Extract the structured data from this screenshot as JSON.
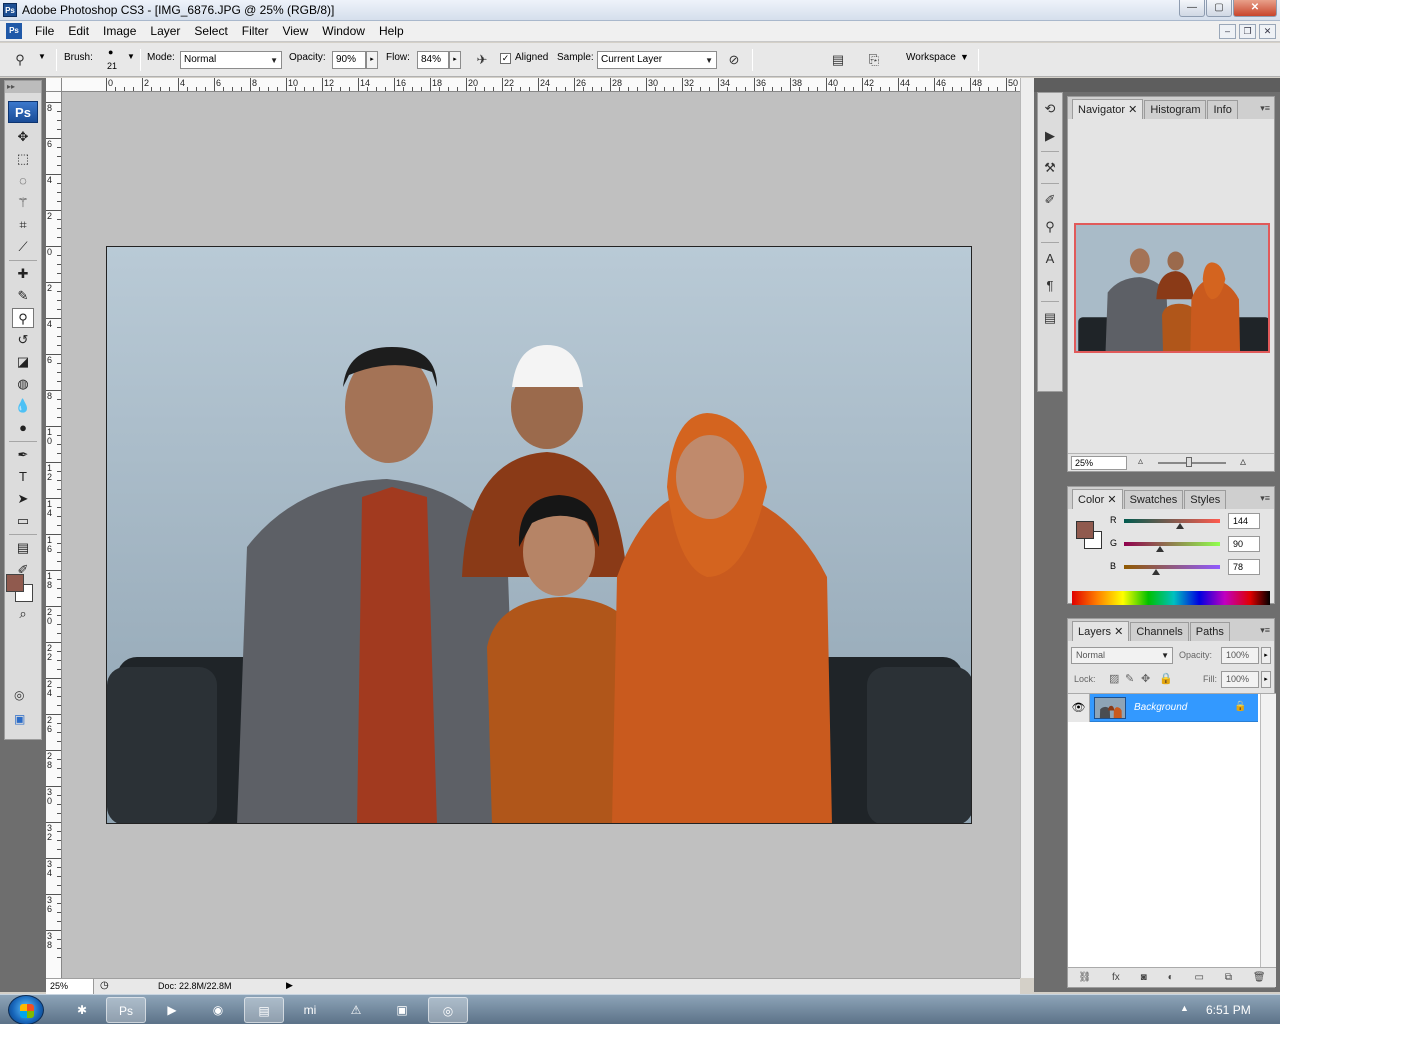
{
  "window": {
    "title": "Adobe Photoshop CS3 - [IMG_6876.JPG @ 25% (RGB/8)]",
    "app_icon": "Ps",
    "min_label": "—",
    "max_label": "▢",
    "close_label": "✕"
  },
  "menu": {
    "items": [
      "File",
      "Edit",
      "Image",
      "Layer",
      "Select",
      "Filter",
      "View",
      "Window",
      "Help"
    ],
    "mdi_min": "–",
    "mdi_restore": "❐",
    "mdi_close": "✕"
  },
  "options": {
    "brush_label": "Brush:",
    "brush_size": "21",
    "mode_label": "Mode:",
    "mode_value": "Normal",
    "opacity_label": "Opacity:",
    "opacity_value": "90%",
    "flow_label": "Flow:",
    "flow_value": "84%",
    "aligned_label": "Aligned",
    "aligned_checked": "✓",
    "sample_label": "Sample:",
    "sample_value": "Current Layer",
    "workspace_label": "Workspace"
  },
  "tools": {
    "logo": "Ps",
    "items": [
      {
        "name": "move-tool",
        "glyph": "✥"
      },
      {
        "name": "marquee-tool",
        "glyph": "⬚"
      },
      {
        "name": "lasso-tool",
        "glyph": "◌"
      },
      {
        "name": "magic-wand-tool",
        "glyph": "⚚"
      },
      {
        "name": "crop-tool",
        "glyph": "⌗"
      },
      {
        "name": "slice-tool",
        "glyph": "⟋"
      },
      {
        "name": "healing-brush-tool",
        "glyph": "✚"
      },
      {
        "name": "brush-tool",
        "glyph": "✎"
      },
      {
        "name": "clone-stamp-tool",
        "glyph": "⚲"
      },
      {
        "name": "history-brush-tool",
        "glyph": "↺"
      },
      {
        "name": "eraser-tool",
        "glyph": "◪"
      },
      {
        "name": "paint-bucket-tool",
        "glyph": "◍"
      },
      {
        "name": "blur-tool",
        "glyph": "💧"
      },
      {
        "name": "dodge-tool",
        "glyph": "●"
      },
      {
        "name": "pen-tool",
        "glyph": "✒"
      },
      {
        "name": "type-tool",
        "glyph": "T"
      },
      {
        "name": "path-selection-tool",
        "glyph": "➤"
      },
      {
        "name": "shape-tool",
        "glyph": "▭"
      },
      {
        "name": "notes-tool",
        "glyph": "▤"
      },
      {
        "name": "eyedropper-tool",
        "glyph": "✐"
      },
      {
        "name": "hand-tool",
        "glyph": "✋"
      },
      {
        "name": "zoom-tool",
        "glyph": "⌕"
      }
    ],
    "quickmask_glyph": "◎",
    "screenmode_glyph": "▣"
  },
  "ruler": {
    "top_labels": [
      "0",
      "2",
      "4",
      "6",
      "8",
      "10",
      "12",
      "14",
      "16",
      "18",
      "20",
      "22",
      "24",
      "26",
      "28",
      "30",
      "32",
      "34",
      "36",
      "38",
      "40",
      "42",
      "44",
      "46",
      "48",
      "50"
    ],
    "left_labels": [
      "8",
      "6",
      "4",
      "2",
      "0",
      "2",
      "4",
      "6",
      "8",
      "10",
      "12",
      "14",
      "16",
      "18",
      "20",
      "22",
      "24",
      "26",
      "28",
      "30",
      "32",
      "34",
      "36",
      "38"
    ]
  },
  "status": {
    "zoom": "25%",
    "doc": "Doc: 22.8M/22.8M",
    "arrow": "▶"
  },
  "navigator": {
    "tabs": [
      "Navigator",
      "Histogram",
      "Info"
    ],
    "zoom": "25%"
  },
  "color_panel": {
    "tabs": [
      "Color",
      "Swatches",
      "Styles"
    ],
    "r_label": "R",
    "r_value": "144",
    "g_label": "G",
    "g_value": "90",
    "b_label": "B",
    "b_value": "78",
    "fg_color": "#905a4e"
  },
  "layers_panel": {
    "tabs": [
      "Layers",
      "Channels",
      "Paths"
    ],
    "blend_mode": "Normal",
    "opacity_label": "Opacity:",
    "opacity_value": "100%",
    "lock_label": "Lock:",
    "fill_label": "Fill:",
    "fill_value": "100%",
    "layer_name": "Background"
  },
  "taskbar": {
    "clock": "6:51 PM"
  }
}
